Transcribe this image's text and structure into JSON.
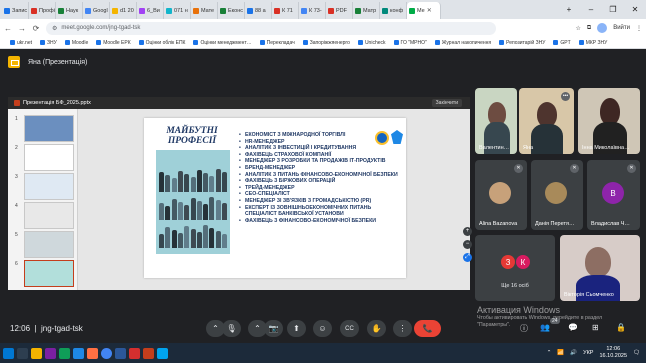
{
  "browser": {
    "tabs": [
      {
        "label": "Запис",
        "color": "#1a73e8"
      },
      {
        "label": "Профі",
        "color": "#d93025"
      },
      {
        "label": "Наук",
        "color": "#188038"
      },
      {
        "label": "Googl",
        "color": "#4285f4"
      },
      {
        "label": "d1 20",
        "color": "#f4b400"
      },
      {
        "label": "6_Ви",
        "color": "#a142f4"
      },
      {
        "label": "071 н",
        "color": "#12b5cb"
      },
      {
        "label": "Мате",
        "color": "#e8710a"
      },
      {
        "label": "Еконс",
        "color": "#188038"
      },
      {
        "label": "88 а",
        "color": "#1a73e8"
      },
      {
        "label": "К 71",
        "color": "#d93025"
      },
      {
        "label": "К 73-",
        "color": "#4285f4"
      },
      {
        "label": "PDF",
        "color": "#d93025"
      },
      {
        "label": "Матр",
        "color": "#188038"
      },
      {
        "label": "конф",
        "color": "#00897b"
      },
      {
        "label": "Ме",
        "color": "#00ac47",
        "active": true
      }
    ],
    "new_tab": "+",
    "window_controls": {
      "minimize": "–",
      "maximize": "❐",
      "close": "✕"
    },
    "url": "meet.google.com/jng-tgad-tsk",
    "sign_in": "Вийти",
    "bookmarks": [
      "ukr.net",
      "ЗНУ",
      "Moodle",
      "Moodle ЕРК",
      "Оцінки облік ЕПК",
      "Оцінки менеджмент…",
      "Перекладач",
      "Запоріжжяенерго",
      "Unicheck",
      "ГО \"МРНО\"",
      "Журнал накопичення",
      "Репозитарій ЗНУ",
      "GPT",
      "МКР ЗНУ"
    ]
  },
  "meet": {
    "presenter_label": "Яна (Презентація)",
    "meeting_time": "12:06",
    "meeting_code": "jng-tgad-tsk",
    "participants_count": "24"
  },
  "presentation": {
    "file_title": "Презентація БФ_2025.pptx",
    "close_label": "Закінчити",
    "thumb_numbers": [
      "1",
      "2",
      "3",
      "4",
      "5",
      "6"
    ],
    "slide_heading": "МАЙБУТНІ ПРОФЕСІЇ",
    "professions": [
      "ЕКОНОМІСТ З МІЖНАРОДНОЇ ТОРГІВЛІ",
      "HR-МЕНЕДЖЕР",
      "АНАЛІТИК З ІНВЕСТИЦІЙ І КРЕДИТУВАННЯ",
      "ФАХІВЕЦЬ СТРАХОВОЇ КОМПАНІЇ",
      "МЕНЕДЖЕР З РОЗРОБКИ ТА ПРОДАЖІВ ІТ-ПРОДУКТІВ",
      "БРЕНД-МЕНЕДЖЕР",
      "АНАЛІТИК З ПИТАНЬ ФІНАНСОВО-ЕКОНОМІЧНОЇ БЕЗПЕКИ",
      "ФАХІВЕЦЬ З БІРЖОВИХ ОПЕРАЦІЙ",
      "ТРЕЙД-МЕНЕДЖЕР",
      "CEO-СПЕЦІАЛІСТ",
      "МЕНЕДЖЕР ЗІ ЗВ'ЯЗКІВ З ГРОМАДСЬКІСТЮ (PR)",
      "ЕКСПЕРТ ІЗ ЗОВНІШНЬОЕКОНОМІЧНИХ ПИТАНЬ СПЕЦІАЛІСТ БАНКІВСЬКОЇ УСТАНОВИ",
      "ФАХІВЕЦЬ З ФІНАНСОВО-ЕКОНОМІЧНОЇ БЕЗПЕКИ"
    ]
  },
  "participants": [
    {
      "name": "Валентин…"
    },
    {
      "name": "Яна"
    },
    {
      "name": "Інна Миколаївна…"
    },
    {
      "name": "Alina Bazanova"
    },
    {
      "name": "Данія Перетя…"
    },
    {
      "name": "Владислав Ч…",
      "initial": "В",
      "color": "#8e24aa"
    },
    {
      "name": "Вікторія Сьомченко"
    }
  ],
  "others": {
    "initials": [
      "З",
      "К"
    ],
    "colors": [
      "#e53935",
      "#d81b60"
    ],
    "label": "Ще 16 осіб"
  },
  "windows_activation": {
    "title": "Активация Windows",
    "text": "Чтобы активировать Windows, перейдите в раздел \"Параметры\"."
  },
  "controls": {
    "more": "⌃",
    "mic": "🎙",
    "camera": "📷",
    "present": "⬆",
    "emoji": "☺",
    "captions": "CC",
    "hand": "✋",
    "more_options": "⋮",
    "end_call": "📞",
    "info": "ⓘ",
    "people": "👥",
    "chat": "💬",
    "activities": "⊞",
    "lock": "🔒"
  },
  "taskbar": {
    "search_placeholder": "Пошук",
    "lang": "УКР",
    "time": "12:06",
    "date": "16.10.2025"
  }
}
